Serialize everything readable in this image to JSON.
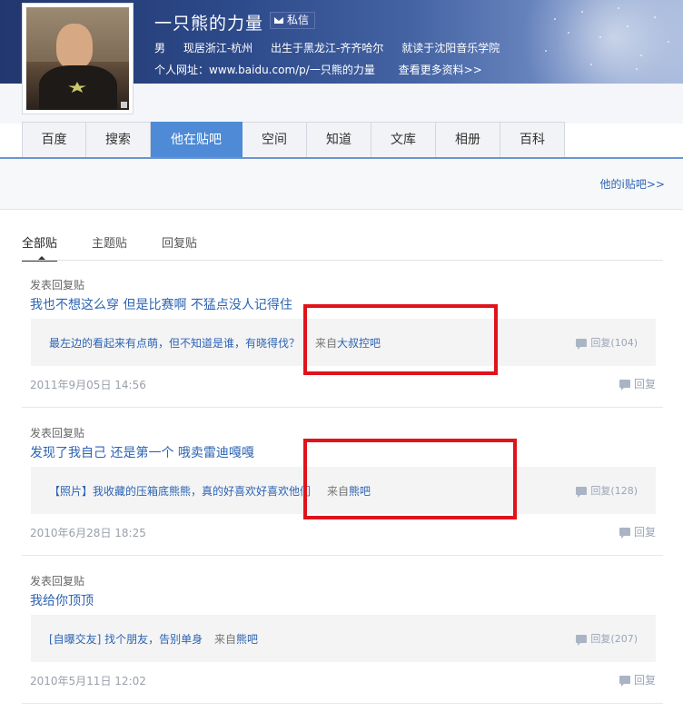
{
  "profile": {
    "name": "一只熊的力量",
    "message_label": "私信",
    "gender": "男",
    "location": "现居浙江-杭州",
    "birthplace": "出生于黑龙江-齐齐哈尔",
    "school": "就读于沈阳音乐学院",
    "homepage_label": "个人网址：www.baidu.com/p/一只熊的力量",
    "more_label": "查看更多资料>>"
  },
  "tabs": [
    {
      "label": "百度"
    },
    {
      "label": "搜索"
    },
    {
      "label": "他在贴吧",
      "active": true
    },
    {
      "label": "空间"
    },
    {
      "label": "知道"
    },
    {
      "label": "文库"
    },
    {
      "label": "相册"
    },
    {
      "label": "百科"
    }
  ],
  "my_bar_label": "他的i贴吧>>",
  "filters": [
    "全部贴",
    "主题贴",
    "回复贴"
  ],
  "posts": [
    {
      "type": "发表回复贴",
      "title": "我也不想这么穿 但是比赛啊 不猛点没人记得住",
      "quote_text": "最左边的看起来有点萌，但不知道是谁，有晓得伐？",
      "from_prefix": "来自",
      "from_bar": "大叔控吧",
      "quote_reply": "回复(104)",
      "date": "2011年9月05日 14:56",
      "reply_label": "回复"
    },
    {
      "type": "发表回复贴",
      "title": "发现了我自己 还是第一个 哦卖雷迪嘎嘎",
      "quote_text": "【照片】我收藏的压箱底熊熊，真的好喜欢好喜欢他们",
      "from_prefix": "来自",
      "from_bar": "熊吧",
      "quote_reply": "回复(128)",
      "date": "2010年6月28日 18:25",
      "reply_label": "回复"
    },
    {
      "type": "发表回复贴",
      "title": "我给你顶顶",
      "quote_text": "[自曝交友] 找个朋友，告别单身",
      "from_prefix": "来自",
      "from_bar": "熊吧",
      "quote_reply": "回复(207)",
      "date": "2010年5月11日 12:02",
      "reply_label": "回复"
    }
  ],
  "colors": {
    "link": "#2d64b3",
    "active_tab": "#4e8ad6",
    "highlight_box": "#e0131b",
    "banner": "#2d4a8a"
  }
}
